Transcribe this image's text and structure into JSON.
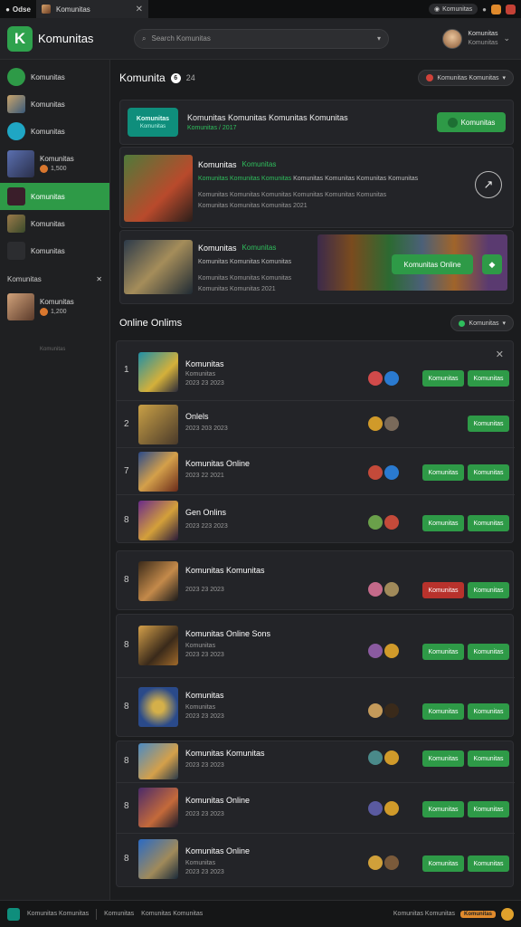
{
  "browser": {
    "tab_mini_label": "Odse",
    "active_tab_title": "Komunitas",
    "profile_pill": "Komunitas"
  },
  "header": {
    "brand": "Komunitas",
    "search_placeholder": "Search Komunitas",
    "user_name": "Komunitas",
    "user_status": "Komunitas"
  },
  "sidebar": {
    "top_label": "Komunitas",
    "items": [
      {
        "label": "Komunitas"
      },
      {
        "label": "Komunitas"
      },
      {
        "label": "Komunitas",
        "sub": "1,500"
      },
      {
        "label": "Komunitas"
      },
      {
        "label": "Komunitas"
      },
      {
        "label": "Komunitas"
      }
    ],
    "section_title": "Komunitas",
    "section_item": {
      "label": "Komunitas",
      "sub": "1,200"
    },
    "note": "Komunitas"
  },
  "main": {
    "title": "Komunita",
    "title_badge": "6",
    "title_count": "24",
    "filter_label": "Komunitas Komunitas",
    "banner": {
      "tag": "Komunitas",
      "tag_sub": "Komunitas",
      "text": "Komunitas Komunitas Komunitas Komunitas",
      "sub": "Komunitas / 2017",
      "button": "Komunitas"
    },
    "feature_one": {
      "title": "Komunitas",
      "highlight": "Komunitas",
      "line1_green": "Komunitas Komunitas Komunitas",
      "line1_rest": "Komunitas Komunitas Komunitas Komunitas",
      "line2": "Komunitas Komunitas Komunitas Komunitas Komunitas Komunitas",
      "line3": "Komunitas Komunitas Komunitas 2021"
    },
    "feature_two": {
      "title": "Komunitas",
      "highlight": "Komunitas",
      "line1": "Komunitas Komunitas Komunitas",
      "line2": "Komunitas Komunitas Komunitas",
      "line3": "Komunitas Komunitas 2021",
      "button": "Komunitas Online"
    },
    "online_title": "Online Onlims",
    "sort_label": "Komunitas"
  },
  "list": [
    {
      "num": "1",
      "name": "Komunitas",
      "sub1": "Komunitas",
      "sub2": "2023 23 2023",
      "b1": "Komunitas",
      "b2": "Komunitas"
    },
    {
      "num": "2",
      "name": "Onlels",
      "sub1": "2023 203 2023",
      "sub2": "",
      "b1": "",
      "b2": "Komunitas"
    },
    {
      "num": "7",
      "name": "Komunitas Online",
      "sub1": "2023 22 2021",
      "sub2": "",
      "b1": "Komunitas",
      "b2": "Komunitas"
    },
    {
      "num": "8",
      "name": "Gen Onlins",
      "sub1": "2023 223 2023",
      "sub2": "",
      "b1": "Komunitas",
      "b2": "Komunitas"
    },
    {
      "num": "8",
      "name": "Komunitas Komunitas",
      "sub1": "2023 23 2023",
      "sub2": "",
      "b1": "Komunitas",
      "b2": "Komunitas"
    },
    {
      "num": "8",
      "name": "Komunitas Online Sons",
      "sub1": "Komunitas",
      "sub2": "2023 23 2023",
      "b1": "Komunitas",
      "b2": "Komunitas"
    },
    {
      "num": "8",
      "name": "Komunitas",
      "sub1": "Komunitas",
      "sub2": "2023 23 2023",
      "b1": "Komunitas",
      "b2": "Komunitas"
    },
    {
      "num": "8",
      "name": "Komunitas Komunitas",
      "sub1": "2023 23 2023",
      "sub2": "",
      "b1": "Komunitas",
      "b2": "Komunitas"
    },
    {
      "num": "8",
      "name": "Komunitas Online",
      "sub1": "2023 23 2023",
      "sub2": "",
      "b1": "Komunitas",
      "b2": "Komunitas"
    },
    {
      "num": "8",
      "name": "Komunitas Online",
      "sub1": "Komunitas",
      "sub2": "2023 23 2023",
      "b1": "Komunitas",
      "b2": "Komunitas"
    }
  ],
  "footer": {
    "left": "Komunitas Komunitas",
    "mid1": "Komunitas",
    "mid2": "Komunitas Komunitas",
    "right": "Komunitas Komunitas",
    "badge": "Komunitas"
  },
  "colors": {
    "accent": "#2e9a47",
    "background": "#1b1c1e",
    "panel": "#232428",
    "danger": "#b8322c",
    "teal": "#0f8e7c"
  }
}
